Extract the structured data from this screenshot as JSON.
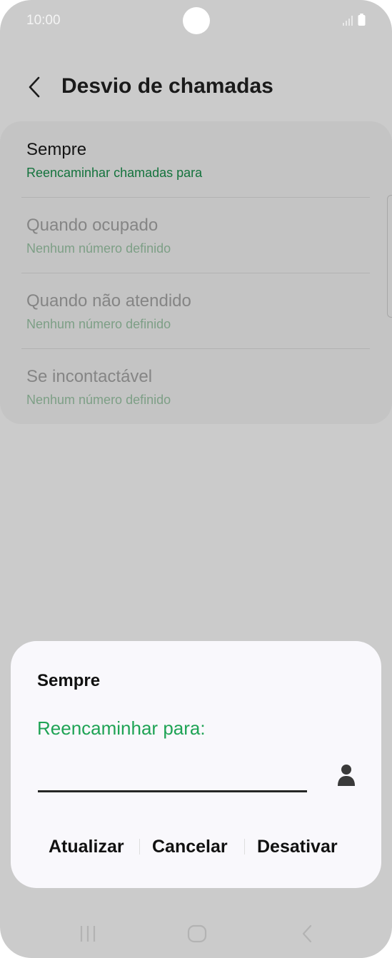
{
  "status_bar": {
    "time": "10:00",
    "icons": [
      "signal-icon",
      "battery-icon"
    ]
  },
  "header": {
    "back_icon": "chevron-left-icon",
    "title": "Desvio de chamadas"
  },
  "forwarding_options": [
    {
      "title": "Sempre",
      "subtitle": "Reencaminhar chamadas para"
    },
    {
      "title": "Quando ocupado",
      "subtitle": "Nenhum número definido"
    },
    {
      "title": "Quando não atendido",
      "subtitle": "Nenhum número definido"
    },
    {
      "title": "Se incontactável",
      "subtitle": "Nenhum número definido"
    }
  ],
  "dialog": {
    "title": "Sempre",
    "field_label": "Reencaminhar para:",
    "phone_value": "",
    "contact_icon": "person-icon",
    "buttons": {
      "update": "Atualizar",
      "cancel": "Cancelar",
      "disable": "Desativar"
    }
  },
  "nav_bar": {
    "icons": [
      "recent-apps-icon",
      "home-icon",
      "back-icon"
    ]
  },
  "colors": {
    "accent_green": "#1fa355",
    "subtitle_green_active": "#14733d",
    "subtitle_green_dimmed": "#7d9f86",
    "text_dimmed": "#858585"
  }
}
